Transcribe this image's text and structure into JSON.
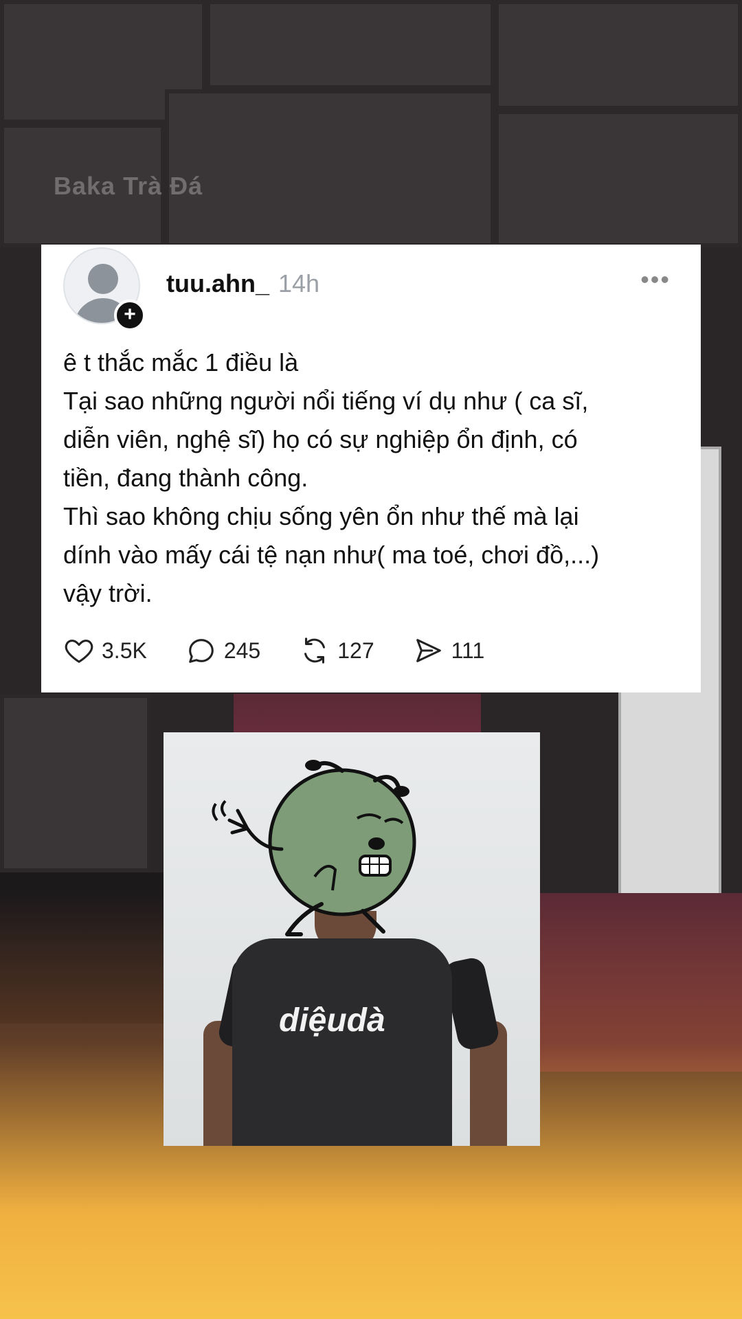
{
  "watermark": "Baka Trà Đá",
  "post": {
    "username": "tuu.ahn_",
    "time": "14h",
    "more_label": "•••",
    "follow_label": "+",
    "lines": [
      "ê t thắc mắc 1 điều là",
      "Tại sao những người nổi tiếng ví dụ như ( ca sĩ,",
      "diễn viên, nghệ sĩ) họ có sự nghiệp ổn định, có",
      "tiền, đang thành công.",
      "Thì sao không chịu sống yên ổn như thế mà lại",
      "dính vào mấy cái tệ nạn như( ma toé, chơi đồ,...)",
      "vậy trời."
    ],
    "actions": {
      "likes": "3.5K",
      "comments": "245",
      "reposts": "127",
      "shares": "111"
    }
  },
  "photo": {
    "shirt_text": "diệudà"
  },
  "icons": [
    "heart-icon",
    "comment-icon",
    "repost-icon",
    "share-icon",
    "more-icon",
    "plus-icon"
  ]
}
